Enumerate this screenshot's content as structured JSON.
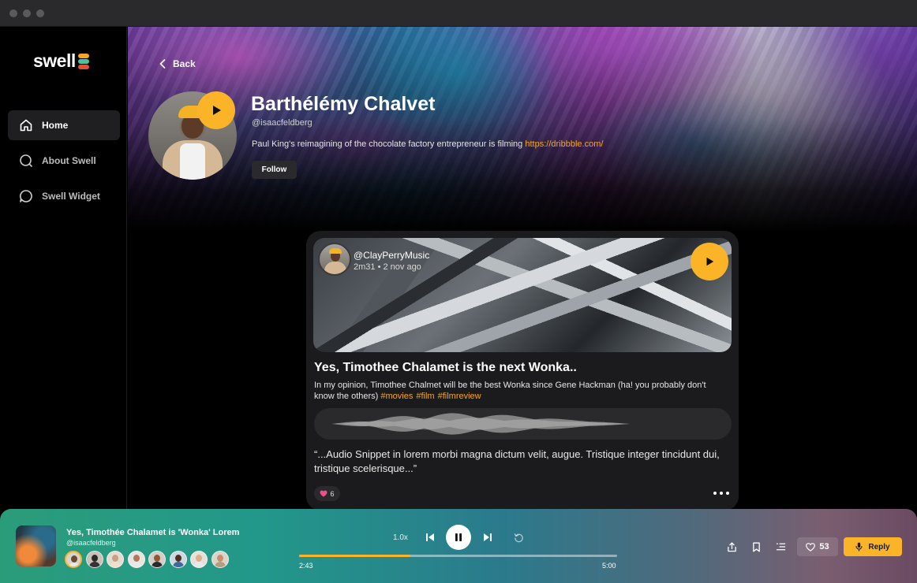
{
  "app": {
    "logo_text": "swell",
    "accent_color": "#fbb428"
  },
  "sidebar": {
    "items": [
      {
        "label": "Home",
        "icon": "home-icon",
        "active": true
      },
      {
        "label": "About Swell",
        "icon": "search-icon",
        "active": false
      },
      {
        "label": "Swell Widget",
        "icon": "chat-bubble-icon",
        "active": false
      }
    ]
  },
  "profile": {
    "back_label": "Back",
    "name": "Barthélémy Chalvet",
    "handle": "@isaacfeldberg",
    "bio": "Paul King's reimagining of the chocolate factory entrepreneur is filming",
    "bio_link": "https://dribbble.com/",
    "follow_label": "Follow"
  },
  "post": {
    "user": "@ClayPerryMusic",
    "meta": "2m31 • 2 nov ago",
    "title": "Yes, Timothee Chalamet is the next Wonka..",
    "body": "In my opinion, Timothee Chalmet will be the best Wonka since Gene Hackman (ha! you probably don't know the others)",
    "hashtags": [
      "#movies",
      "#film",
      "#filmreview"
    ],
    "quote": "“...Audio Snippet in lorem morbi magna dictum velit, augue. Tristique integer tincidunt dui, tristique scelerisque...”",
    "likes": "6"
  },
  "player": {
    "title": "Yes, Timothée Chalamet is 'Wonka' Lorem",
    "handle": "@isaacfeldberg",
    "speed": "1.0x",
    "current_time": "2:43",
    "total_time": "5:00",
    "progress": 0.35,
    "likes": "53",
    "reply_label": "Reply"
  }
}
